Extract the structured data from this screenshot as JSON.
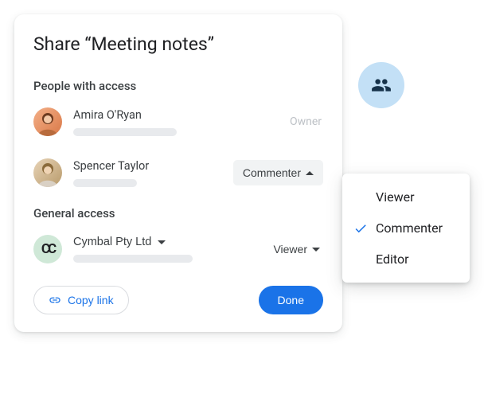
{
  "title": "Share “Meeting notes”",
  "sections": {
    "people_label": "People with access",
    "general_label": "General access"
  },
  "people": [
    {
      "name": "Amira O'Ryan",
      "role_label": "Owner"
    },
    {
      "name": "Spencer Taylor",
      "role_label": "Commenter"
    }
  ],
  "org": {
    "name": "Cymbal Pty Ltd",
    "logo_text": "CC",
    "role_label": "Viewer"
  },
  "footer": {
    "copy_link": "Copy link",
    "done": "Done"
  },
  "role_menu": {
    "options": [
      "Viewer",
      "Commenter",
      "Editor"
    ],
    "selected": "Commenter"
  }
}
